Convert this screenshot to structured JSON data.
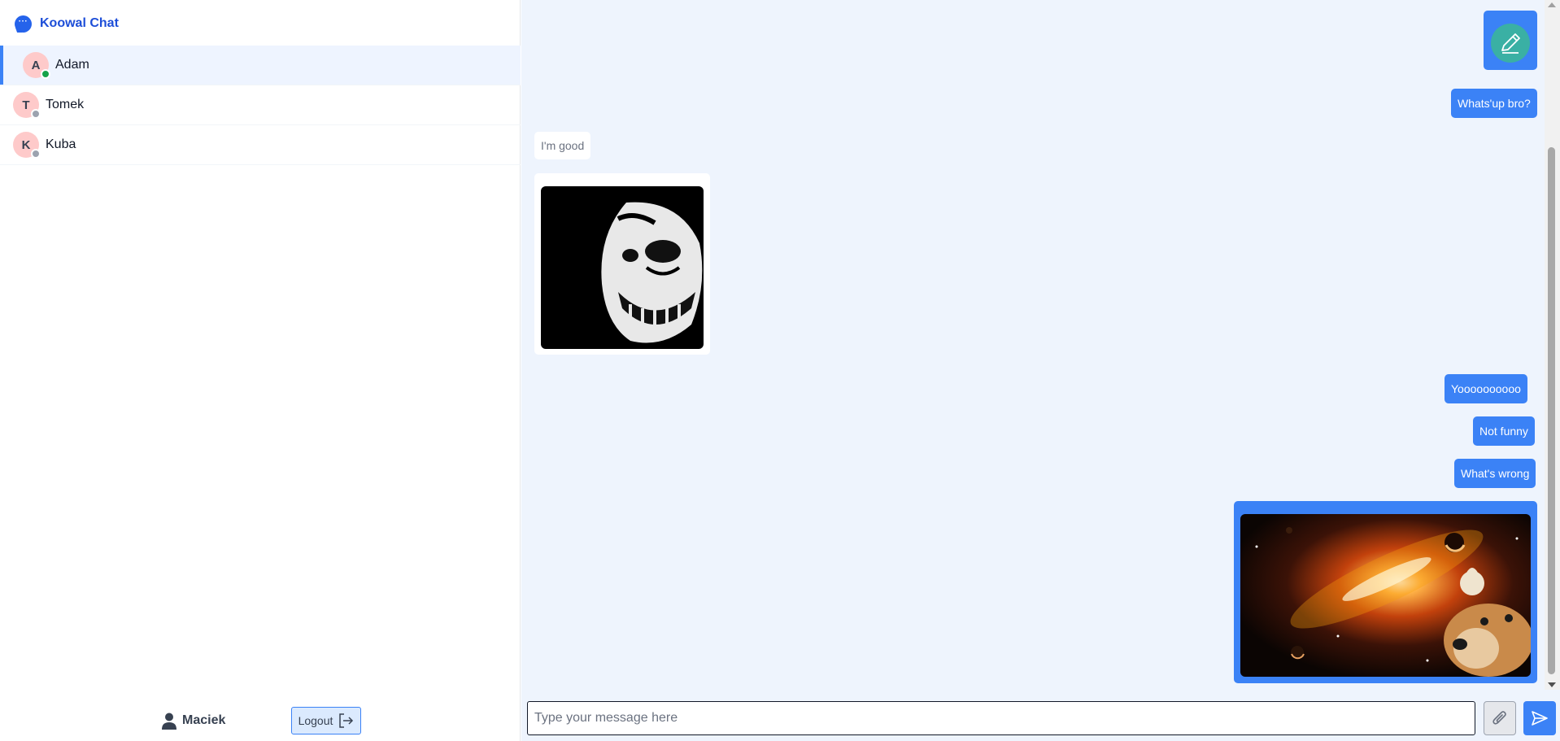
{
  "app": {
    "title": "Koowal Chat",
    "logo_icon": "chat-bubble-icon"
  },
  "contacts": [
    {
      "initial": "A",
      "name": "Adam",
      "status": "online",
      "active": true
    },
    {
      "initial": "T",
      "name": "Tomek",
      "status": "offline",
      "active": false
    },
    {
      "initial": "K",
      "name": "Kuba",
      "status": "offline",
      "active": false
    }
  ],
  "current_user": {
    "name": "Maciek",
    "icon": "user-icon"
  },
  "logout": {
    "label": "Logout",
    "icon": "logout-icon"
  },
  "messages": [
    {
      "kind": "image",
      "direction": "out",
      "image": "pencil-icon"
    },
    {
      "kind": "text",
      "direction": "out",
      "text": "Whats'up bro?"
    },
    {
      "kind": "text",
      "direction": "in",
      "text": "I'm good"
    },
    {
      "kind": "image",
      "direction": "in",
      "image": "troll-face-image"
    },
    {
      "kind": "text",
      "direction": "out",
      "text": "Yoooooooooo"
    },
    {
      "kind": "text",
      "direction": "out",
      "text": "Not funny"
    },
    {
      "kind": "text",
      "direction": "out",
      "text": "What's wrong"
    },
    {
      "kind": "image",
      "direction": "out",
      "image": "space-dog-image"
    }
  ],
  "composer": {
    "placeholder": "Type your message here",
    "attach_icon": "paperclip-icon",
    "send_icon": "send-icon"
  },
  "colors": {
    "accent": "#3b82f6",
    "brand": "#1d4ed8",
    "chat_bg": "#eef4fd",
    "online": "#16a34a",
    "offline": "#9ca3af",
    "avatar_bg": "#fecaca"
  }
}
